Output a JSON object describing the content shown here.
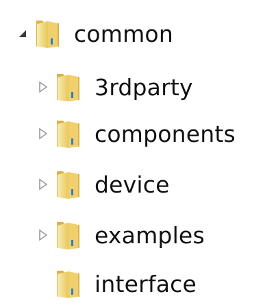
{
  "tree": {
    "root": {
      "label": "common",
      "expanded": true,
      "icon": "folder-icon"
    },
    "children": [
      {
        "label": "3rdparty",
        "expanded": false,
        "has_children": true,
        "icon": "folder-icon"
      },
      {
        "label": "components",
        "expanded": false,
        "has_children": true,
        "icon": "folder-icon"
      },
      {
        "label": "device",
        "expanded": false,
        "has_children": true,
        "icon": "folder-icon"
      },
      {
        "label": "examples",
        "expanded": false,
        "has_children": true,
        "icon": "folder-icon"
      },
      {
        "label": "interface",
        "expanded": false,
        "has_children": false,
        "icon": "folder-icon"
      }
    ]
  },
  "colors": {
    "folder_light": "#f7e59a",
    "folder_mid": "#e8c65a",
    "folder_dark": "#c9a032",
    "expander_collapsed": "#9a9a9a",
    "expander_expanded": "#3c3c3c",
    "text": "#111111"
  }
}
